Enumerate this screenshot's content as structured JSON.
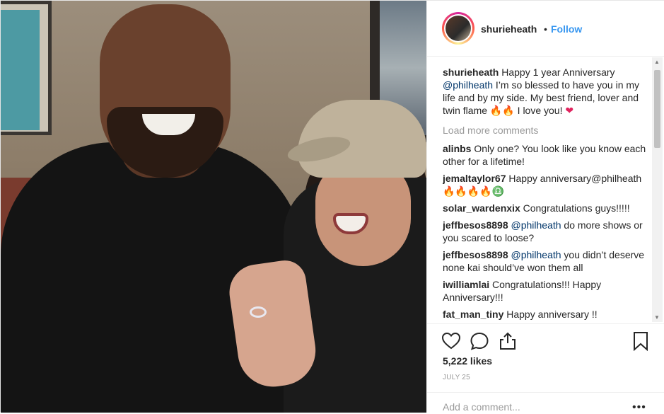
{
  "post": {
    "username": "shurieheath",
    "separator": "•",
    "follow_label": "Follow",
    "caption": {
      "username": "shurieheath",
      "text_before": "Happy 1 year Anniversary ",
      "mention": "@philheath",
      "text_after": " I’m so blessed to have you in my life and by my side. My best friend, lover and twin flame 🔥🔥 I love you! ",
      "heart": "❤"
    },
    "load_more_label": "Load more comments",
    "comments": [
      {
        "username": "alinbs",
        "text": "Only one? You look like you know each other for a lifetime!"
      },
      {
        "username": "jemaltaylor67",
        "text": "Happy anniversary@philheath🔥🔥🔥🔥♎"
      },
      {
        "username": "solar_wardenxix",
        "text": "Congratulations guys!!!!!"
      },
      {
        "username": "jeffbesos8898",
        "mention": "@philheath",
        "text": " do more shows or you scared to loose?"
      },
      {
        "username": "jeffbesos8898",
        "mention": "@philheath",
        "text": " you didn’t deserve none kai should’ve won them all"
      },
      {
        "username": "iwilliamlai",
        "text": "Congratulations!!! Happy Anniversary!!!"
      },
      {
        "username": "fat_man_tiny",
        "text": "Happy anniversary !!"
      }
    ],
    "likes": "5,222 likes",
    "date": "JULY 25",
    "add_comment_placeholder": "Add a comment...",
    "more_label": "•••"
  },
  "icons": {
    "like": "heart-outline-icon",
    "comment": "speech-bubble-icon",
    "share": "share-icon",
    "save": "bookmark-icon"
  },
  "colors": {
    "link": "#3897f0",
    "mention": "#003569",
    "muted": "#999999"
  }
}
